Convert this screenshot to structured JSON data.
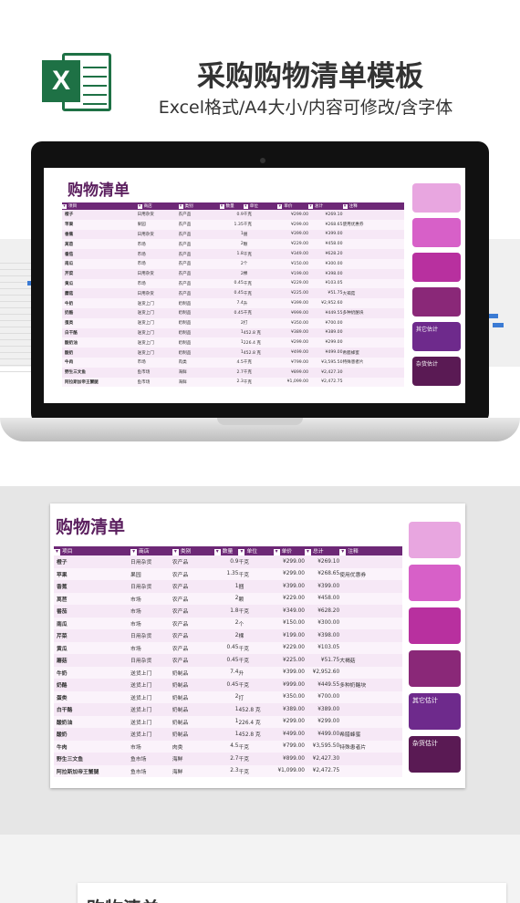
{
  "header": {
    "logo_letter": "X",
    "title": "采购购物清单模板",
    "subtitle": "Excel格式/A4大小/内容可修改/含字体"
  },
  "sheet": {
    "title": "购物清单",
    "columns": [
      "项目",
      "商店",
      "类别",
      "数量",
      "单位",
      "单价",
      "总计",
      "注释"
    ],
    "rows": [
      {
        "item": "橙子",
        "store": "日用杂货",
        "category": "农产品",
        "qty": "0.9",
        "unit": "千克",
        "price": "¥299.00",
        "total": "¥269.10",
        "note": ""
      },
      {
        "item": "苹果",
        "store": "果园",
        "category": "农产品",
        "qty": "1.35",
        "unit": "千克",
        "price": "¥299.00",
        "total": "¥268.65",
        "note": "使用优惠券"
      },
      {
        "item": "香蕉",
        "store": "日用杂货",
        "category": "农产品",
        "qty": "1",
        "unit": "捆",
        "price": "¥399.00",
        "total": "¥399.00",
        "note": ""
      },
      {
        "item": "莴苣",
        "store": "市场",
        "category": "农产品",
        "qty": "2",
        "unit": "颗",
        "price": "¥229.00",
        "total": "¥458.00",
        "note": ""
      },
      {
        "item": "番茄",
        "store": "市场",
        "category": "农产品",
        "qty": "1.8",
        "unit": "千克",
        "price": "¥349.00",
        "total": "¥628.20",
        "note": ""
      },
      {
        "item": "南瓜",
        "store": "市场",
        "category": "农产品",
        "qty": "2",
        "unit": "个",
        "price": "¥150.00",
        "total": "¥300.00",
        "note": ""
      },
      {
        "item": "芹菜",
        "store": "日用杂货",
        "category": "农产品",
        "qty": "2",
        "unit": "棵",
        "price": "¥199.00",
        "total": "¥398.00",
        "note": ""
      },
      {
        "item": "黄瓜",
        "store": "市场",
        "category": "农产品",
        "qty": "0.45",
        "unit": "千克",
        "price": "¥229.00",
        "total": "¥103.05",
        "note": ""
      },
      {
        "item": "蘑菇",
        "store": "日用杂货",
        "category": "农产品",
        "qty": "0.45",
        "unit": "千克",
        "price": "¥225.00",
        "total": "¥51.75",
        "note": "大褐菇"
      },
      {
        "item": "牛奶",
        "store": "送货上门",
        "category": "奶制品",
        "qty": "7.4",
        "unit": "升",
        "price": "¥399.00",
        "total": "¥2,952.60",
        "note": ""
      },
      {
        "item": "奶酪",
        "store": "送货上门",
        "category": "奶制品",
        "qty": "0.45",
        "unit": "千克",
        "price": "¥999.00",
        "total": "¥449.55",
        "note": "多种奶酪块"
      },
      {
        "item": "蛋类",
        "store": "送货上门",
        "category": "奶制品",
        "qty": "2",
        "unit": "打",
        "price": "¥350.00",
        "total": "¥700.00",
        "note": ""
      },
      {
        "item": "白干酪",
        "store": "送货上门",
        "category": "奶制品",
        "qty": "1",
        "unit": "452.8 克",
        "price": "¥389.00",
        "total": "¥389.00",
        "note": ""
      },
      {
        "item": "酸奶油",
        "store": "送货上门",
        "category": "奶制品",
        "qty": "1",
        "unit": "226.4 克",
        "price": "¥299.00",
        "total": "¥299.00",
        "note": ""
      },
      {
        "item": "酸奶",
        "store": "送货上门",
        "category": "奶制品",
        "qty": "1",
        "unit": "452.8 克",
        "price": "¥499.00",
        "total": "¥499.00",
        "note": "希腊蜂蜜"
      },
      {
        "item": "牛肉",
        "store": "市场",
        "category": "肉类",
        "qty": "4.5",
        "unit": "千克",
        "price": "¥799.00",
        "total": "¥3,595.50",
        "note": "特殊患者片"
      },
      {
        "item": "野生三文鱼",
        "store": "鱼市场",
        "category": "海鲜",
        "qty": "2.7",
        "unit": "千克",
        "price": "¥899.00",
        "total": "¥2,427.30",
        "note": ""
      },
      {
        "item": "阿拉斯加帝王蟹腿",
        "store": "鱼市场",
        "category": "海鲜",
        "qty": "2.3",
        "unit": "千克",
        "price": "¥1,099.00",
        "total": "¥2,472.75",
        "note": ""
      }
    ],
    "tiles": [
      "",
      "",
      "",
      "",
      "其它估计",
      "杂货估计"
    ]
  },
  "colors": {
    "header_purple": "#6d2876",
    "tile_colors": [
      "#e8a6e0",
      "#d760c8",
      "#b8309f",
      "#8a2878",
      "#6e2a8c",
      "#5a1a54"
    ],
    "excel_green": "#1e7145"
  },
  "bottom": {
    "title": "购物清单"
  }
}
